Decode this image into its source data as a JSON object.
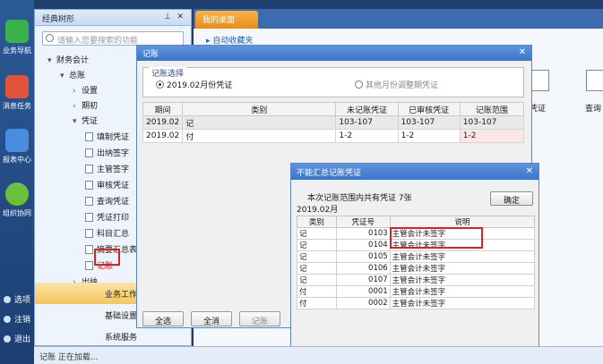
{
  "leftbar": {
    "items": [
      "业务导航",
      "消息任务",
      "报表中心",
      "组织协同"
    ],
    "links": [
      "选项",
      "注销",
      "退出"
    ]
  },
  "tree": {
    "title": "经典树形",
    "search_placeholder": "请输入您要搜索的功能",
    "nodes": {
      "finance": "财务会计",
      "gl": "总账",
      "setup": "设置",
      "period_init": "期初",
      "voucher": "凭证",
      "fill": "填制凭证",
      "cashier_sign": "出纳签字",
      "supervisor_sign": "主管签字",
      "audit": "审核凭证",
      "query": "查询凭证",
      "print": "凭证打印",
      "summary": "科目汇总",
      "abstract_summary": "摘要汇总表",
      "post": "记账",
      "cashier": "出纳"
    },
    "bottom": [
      "业务工作",
      "基础设置",
      "系统服务"
    ]
  },
  "desktop": {
    "tab": "我的桌面",
    "favorites": "自动收藏夹",
    "right_icons": [
      "凭证",
      "查询"
    ]
  },
  "post_dialog": {
    "title": "记账",
    "group_caption": "记账选择",
    "radio_month": "2019.02月份凭证",
    "radio_other": "其他月份调整期凭证",
    "columns": [
      "期间",
      "类别",
      "未记账凭证",
      "已审核凭证",
      "记账范围"
    ],
    "rows": [
      [
        "2019.02",
        "记",
        "103-107",
        "103-107",
        "103-107"
      ],
      [
        "2019.02",
        "付",
        "1-2",
        "1-2",
        "1-2"
      ]
    ],
    "buttons": [
      "全选",
      "全消",
      "记账"
    ]
  },
  "error_dialog": {
    "title": "不能汇总记账凭证",
    "summary": "本次记账范围内共有凭证 7张",
    "period": "2019.02月",
    "ok_label": "确定",
    "columns": [
      "类别",
      "凭证号",
      "说明"
    ],
    "rows": [
      [
        "记",
        "0103",
        "主管会计未签字"
      ],
      [
        "记",
        "0104",
        "主管会计未签字"
      ],
      [
        "记",
        "0105",
        "主管会计未签字"
      ],
      [
        "记",
        "0106",
        "主管会计未签字"
      ],
      [
        "记",
        "0107",
        "主管会计未签字"
      ],
      [
        "付",
        "0001",
        "主管会计未签字"
      ],
      [
        "付",
        "0002",
        "主管会计未签字"
      ]
    ]
  },
  "status": "记账 正在加载..."
}
